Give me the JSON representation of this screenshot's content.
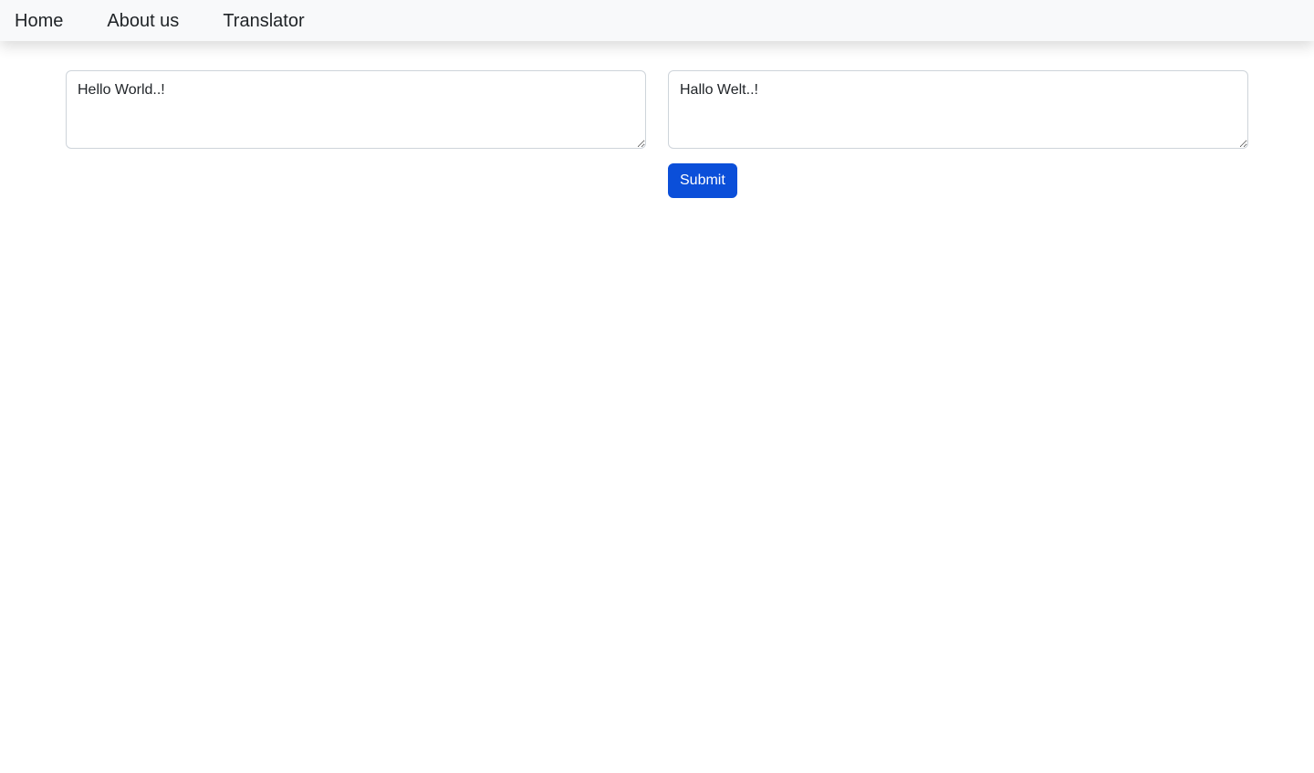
{
  "nav": {
    "items": [
      {
        "label": "Home"
      },
      {
        "label": "About us"
      },
      {
        "label": "Translator"
      }
    ]
  },
  "translator": {
    "source_text": "Hello World..!",
    "target_text": "Hallo Welt..!",
    "submit_label": "Submit"
  },
  "colors": {
    "navbar_bg": "#f8f9fa",
    "primary_button": "#0b4fd9",
    "border": "#ced4da"
  }
}
